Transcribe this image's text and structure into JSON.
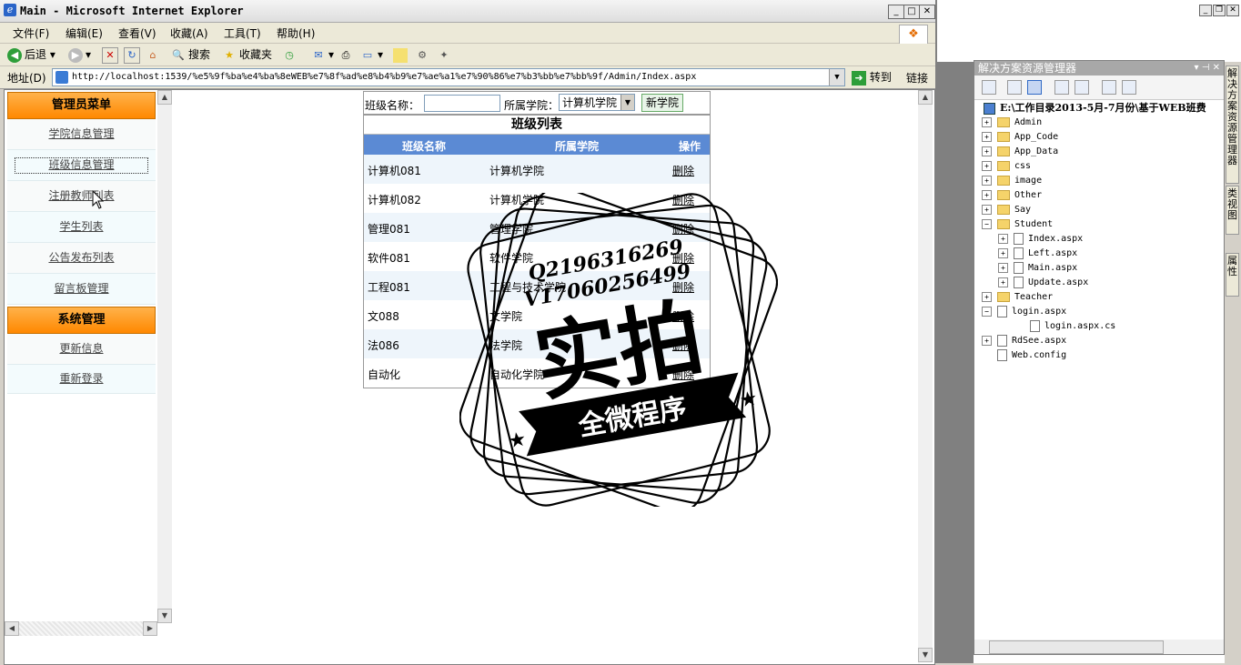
{
  "ie": {
    "title": "Main - Microsoft Internet Explorer",
    "menu": [
      "文件(F)",
      "编辑(E)",
      "查看(V)",
      "收藏(A)",
      "工具(T)",
      "帮助(H)"
    ],
    "toolbar": {
      "back": "后退",
      "search": "搜索",
      "favorites": "收藏夹"
    },
    "address_label": "地址(D)",
    "address_url": "http://localhost:1539/%e5%9f%ba%e4%ba%8eWEB%e7%8f%ad%e8%b4%b9%e7%ae%a1%e7%90%86%e7%b3%bb%e7%bb%9f/Admin/Index.aspx",
    "go_label": "转到",
    "links_label": "链接"
  },
  "left_menu": {
    "admin_header": "管理员菜单",
    "admin_items": [
      "学院信息管理",
      "班级信息管理",
      "注册教师列表",
      "学生列表",
      "公告发布列表",
      "留言板管理"
    ],
    "system_header": "系统管理",
    "system_items": [
      "更新信息",
      "重新登录"
    ]
  },
  "search": {
    "class_name_label": "班级名称：",
    "college_label": "所属学院：",
    "college_selected": "计算机学院",
    "add_college_button": "新学院"
  },
  "class_table": {
    "title": "班级列表",
    "headers": [
      "班级名称",
      "所属学院",
      "操作"
    ],
    "rows": [
      {
        "name": "计算机081",
        "college": "计算机学院",
        "action": "删除"
      },
      {
        "name": "计算机082",
        "college": "计算机学院",
        "action": "删除"
      },
      {
        "name": "管理081",
        "college": "管理学院",
        "action": "删除"
      },
      {
        "name": "软件081",
        "college": "软件学院",
        "action": "删除"
      },
      {
        "name": "工程081",
        "college": "工程与技术学院",
        "action": "删除"
      },
      {
        "name": "文088",
        "college": "文学院",
        "action": "删除"
      },
      {
        "name": "法086",
        "college": "法学院",
        "action": "删除"
      },
      {
        "name": "自动化",
        "college": "自动化学院",
        "action": "删除"
      }
    ]
  },
  "watermark": {
    "qq": "Q2196316269",
    "wechat": "V17060256499",
    "big": "实拍",
    "ribbon": "全微程序"
  },
  "vs": {
    "panel_title": "解决方案资源管理器",
    "tree": [
      {
        "label": "E:\\工作目录2013-5月-7月份\\基于WEB班费",
        "kind": "project"
      },
      {
        "label": "Admin",
        "kind": "folder"
      },
      {
        "label": "App_Code",
        "kind": "folder"
      },
      {
        "label": "App_Data",
        "kind": "folder"
      },
      {
        "label": "css",
        "kind": "folder"
      },
      {
        "label": "image",
        "kind": "folder"
      },
      {
        "label": "Other",
        "kind": "folder"
      },
      {
        "label": "Say",
        "kind": "folder"
      },
      {
        "label": "Student",
        "kind": "folder-open"
      },
      {
        "label": "Index.aspx",
        "kind": "file"
      },
      {
        "label": "Left.aspx",
        "kind": "file"
      },
      {
        "label": "Main.aspx",
        "kind": "file"
      },
      {
        "label": "Update.aspx",
        "kind": "file"
      },
      {
        "label": "Teacher",
        "kind": "folder"
      },
      {
        "label": "login.aspx",
        "kind": "file"
      },
      {
        "label": "login.aspx.cs",
        "kind": "file"
      },
      {
        "label": "RdSee.aspx",
        "kind": "file"
      },
      {
        "label": "Web.config",
        "kind": "file"
      }
    ],
    "side_tabs": [
      "解决方案资源管理器",
      "类视图",
      "属性"
    ]
  },
  "colors": {
    "menu_header": "#ff8800",
    "table_header": "#5b8ad4"
  }
}
